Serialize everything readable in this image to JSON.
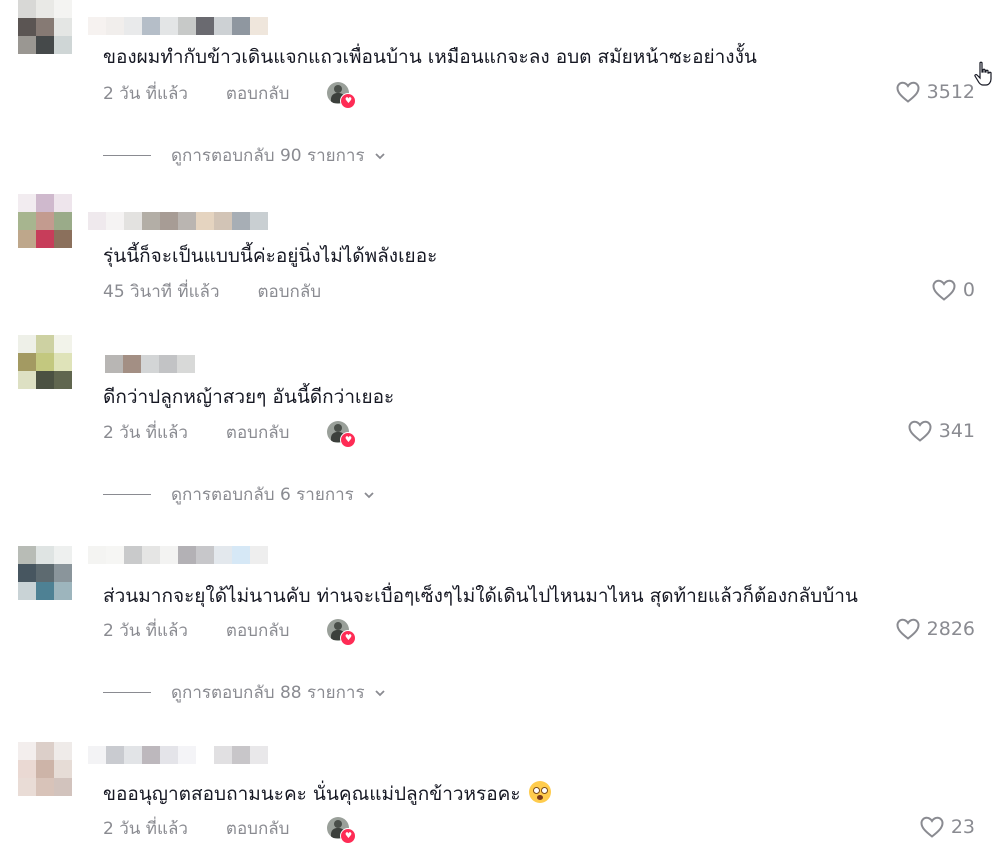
{
  "comments": [
    {
      "text": "ของผมทำกับข้าวเดินแจกแถวเพื่อนบ้าน เหมือนแกจะลง อบต สมัยหน้าซะอย่างงั้น",
      "time": "2 วัน ที่แล้ว",
      "reply_label": "ตอบกลับ",
      "likes": "3512",
      "creator_liked": true,
      "view_replies": "ดูการตอบกลับ 90 รายการ"
    },
    {
      "text": "รุ่นนี้ก็จะเป็นแบบนี้ค่ะอยู่นิ่งไม่ได้พลังเยอะ",
      "time": "45 วินาที ที่แล้ว",
      "reply_label": "ตอบกลับ",
      "likes": "0",
      "creator_liked": false,
      "view_replies": ""
    },
    {
      "text": "ดีกว่าปลูกหญ้าสวยๆ อันนี้ดีกว่าเยอะ",
      "time": "2 วัน ที่แล้ว",
      "reply_label": "ตอบกลับ",
      "likes": "341",
      "creator_liked": true,
      "view_replies": "ดูการตอบกลับ 6 รายการ"
    },
    {
      "text": "ส่วนมากจะยุใด้ไม่นานคับ ท่านจะเบื่อๆเซ็งๆไม่ใด้เดินไปไหนมาไหน สุดท้ายแล้วก็ต้องกลับบ้าน",
      "time": "2 วัน ที่แล้ว",
      "reply_label": "ตอบกลับ",
      "likes": "2826",
      "creator_liked": true,
      "view_replies": "ดูการตอบกลับ 88 รายการ"
    },
    {
      "text": "ขออนุญาตสอบถามนะคะ นั่นคุณแม่ปลูกข้าวหรอคะ",
      "time": "2 วัน ที่แล้ว",
      "reply_label": "ตอบกลับ",
      "likes": "23",
      "creator_liked": true,
      "view_replies": ""
    }
  ],
  "icons": {
    "heart": "heart-outline-icon",
    "chevron": "chevron-down-icon",
    "emoji": "flushed-face-emoji",
    "cursor": "hand-pointer-cursor"
  },
  "colors": {
    "text": "#161823",
    "meta": "#8a8b91",
    "accent": "#fe2c55"
  }
}
